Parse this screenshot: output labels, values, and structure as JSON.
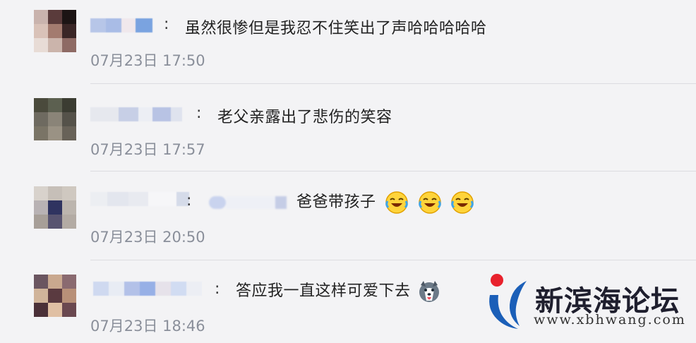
{
  "comments": [
    {
      "text": "虽然很惨但是我忍不住笑出了声哈哈哈哈哈",
      "colon": ":",
      "time": "07月23日 17:50"
    },
    {
      "text": "老父亲露出了悲伤的笑容",
      "colon": ":",
      "time": "07月23日 17:57"
    },
    {
      "text": "爸爸带孩子",
      "colon": ":",
      "time": "07月23日 20:50",
      "emojis": [
        "laugh-cry-emoji",
        "laugh-cry-emoji",
        "laugh-cry-emoji"
      ]
    },
    {
      "text": "答应我一直这样可爱下去",
      "colon": ":",
      "time": "07月23日 18:46",
      "emojis": [
        "husky-emoji"
      ]
    }
  ],
  "watermark": {
    "name": "新滨海论坛",
    "url": "www.xbhwang.com",
    "colors": {
      "red": "#e8212c",
      "blue": "#1b5fb8"
    }
  },
  "colors": {
    "background": "#f3f3f5",
    "text": "#222222",
    "time": "#8a8f9a",
    "divider": "#dcdce0"
  }
}
